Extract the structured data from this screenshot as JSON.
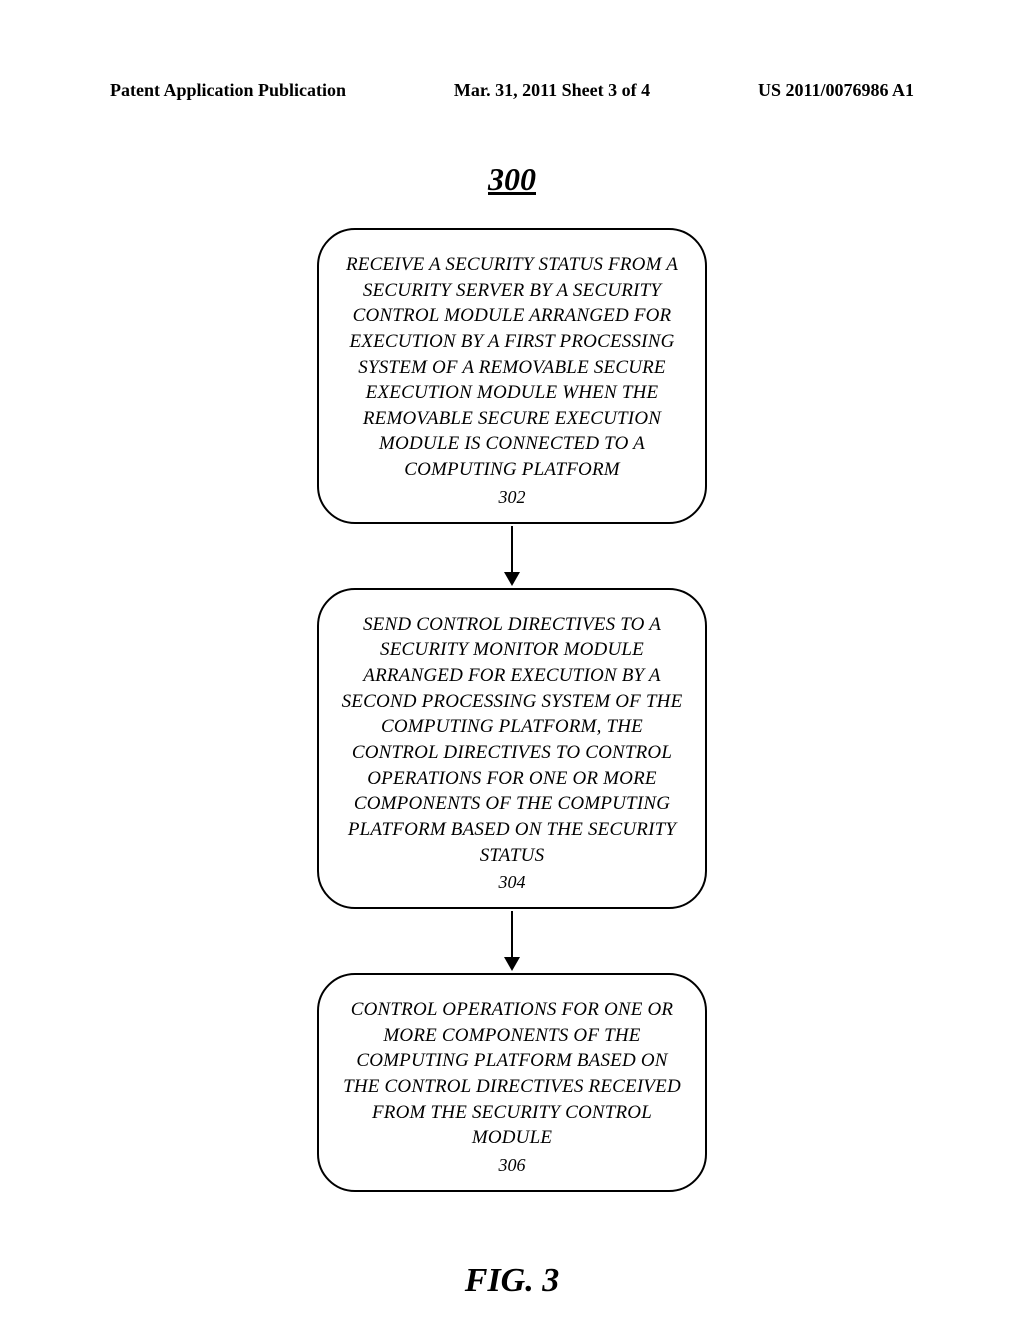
{
  "header": {
    "left": "Patent Application Publication",
    "center": "Mar. 31, 2011  Sheet 3 of 4",
    "right": "US 2011/0076986 A1"
  },
  "figure_number": "300",
  "boxes": [
    {
      "text": "RECEIVE A SECURITY STATUS FROM A SECURITY SERVER BY A SECURITY CONTROL MODULE ARRANGED FOR EXECUTION BY A FIRST PROCESSING SYSTEM OF A REMOVABLE SECURE EXECUTION MODULE WHEN THE REMOVABLE SECURE EXECUTION MODULE IS CONNECTED TO A COMPUTING PLATFORM",
      "num": "302"
    },
    {
      "text": "SEND CONTROL DIRECTIVES TO A SECURITY MONITOR MODULE ARRANGED FOR EXECUTION BY A SECOND PROCESSING SYSTEM OF THE COMPUTING PLATFORM, THE CONTROL DIRECTIVES TO CONTROL OPERATIONS FOR ONE OR MORE COMPONENTS OF THE COMPUTING PLATFORM BASED ON THE SECURITY STATUS",
      "num": "304"
    },
    {
      "text": "CONTROL OPERATIONS FOR ONE OR MORE COMPONENTS OF THE COMPUTING PLATFORM BASED ON THE CONTROL DIRECTIVES RECEIVED FROM THE SECURITY CONTROL MODULE",
      "num": "306"
    }
  ],
  "figure_label": "FIG. 3"
}
